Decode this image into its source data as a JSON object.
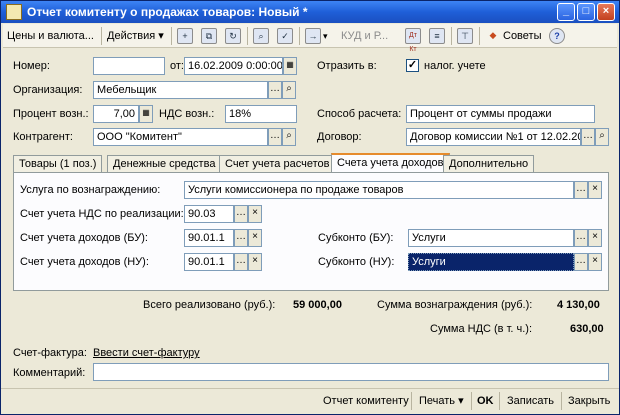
{
  "window": {
    "title": "Отчет комитенту о продажах товаров: Новый *",
    "minimize": "_",
    "maximize": "□",
    "close": "×"
  },
  "toolbar": {
    "prices": "Цены и валюта...",
    "actions": "Действия ▾",
    "kud": "КУД и Р...",
    "dtkt": "Дт Кт",
    "tips": "Советы",
    "help": "?"
  },
  "form": {
    "number_label": "Номер:",
    "number_value": "",
    "from_label": "от:",
    "date_value": "16.02.2009  0:00:00",
    "reflect_label": "Отразить в:",
    "tax_checked": "✓",
    "tax_label": "налог. учете",
    "org_label": "Организация:",
    "org_value": "Мебельщик",
    "percent_label": "Процент возн.:",
    "percent_value": "7,00",
    "vat_label": "НДС возн.:",
    "vat_value": "18%",
    "calc_label": "Способ расчета:",
    "calc_value": "Процент от суммы продажи",
    "contractor_label": "Контрагент:",
    "contractor_value": "ООО \"Комитент\"",
    "contract_label": "Договор:",
    "contract_value": "Договор комиссии №1 от 12.02.2009"
  },
  "tabs": [
    {
      "label": "Товары (1 поз.)"
    },
    {
      "label": "Денежные средства"
    },
    {
      "label": "Счет учета расчетов"
    },
    {
      "label": "Счета учета доходов"
    },
    {
      "label": "Дополнительно"
    }
  ],
  "panel": {
    "service_label": "Услуга по вознаграждению:",
    "service_value": "Услуги комиссионера по продаже товаров",
    "vat_account_label": "Счет учета НДС по реализации:",
    "vat_account_value": "90.03",
    "income_bu_label": "Счет учета доходов (БУ):",
    "income_bu_value": "90.01.1",
    "income_nu_label": "Счет учета доходов (НУ):",
    "income_nu_value": "90.01.1",
    "subconto_bu_label": "Субконто (БУ):",
    "subconto_bu_value": "Услуги",
    "subconto_nu_label": "Субконто (НУ):",
    "subconto_nu_value": "Услуги"
  },
  "totals": {
    "sold_label": "Всего реализовано (руб.):",
    "sold_value": "59 000,00",
    "reward_label": "Сумма вознаграждения (руб.):",
    "reward_value": "4 130,00",
    "vat_label": "Сумма НДС (в т. ч.):",
    "vat_value": "630,00"
  },
  "invoice": {
    "label": "Счет-фактура:",
    "link": "Ввести счет-фактуру"
  },
  "comment": {
    "label": "Комментарий:",
    "value": ""
  },
  "footer": {
    "report": "Отчет комитенту",
    "print": "Печать ▾",
    "ok": "OK",
    "save": "Записать",
    "close": "Закрыть"
  }
}
